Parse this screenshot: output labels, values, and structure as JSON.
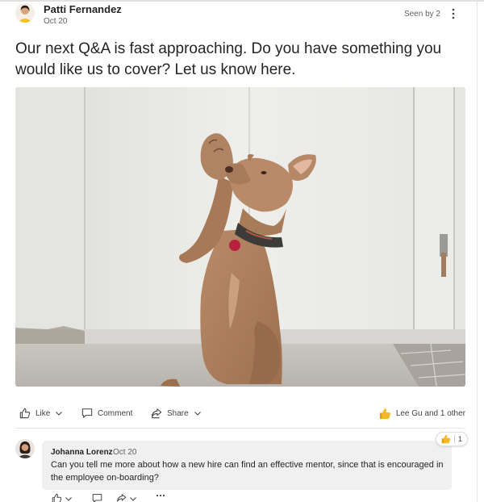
{
  "post": {
    "author": "Patti Fernandez",
    "date": "Oct 20",
    "seen_by": "Seen by 2",
    "text": "Our next Q&A is fast approaching. Do you have something you would like us to cover? Let us know here."
  },
  "actions": {
    "like_label": "Like",
    "comment_label": "Comment",
    "share_label": "Share",
    "reactors_label": "Lee Gu and 1 other"
  },
  "comment": {
    "author": "Johanna Lorenz",
    "date": "Oct 20",
    "text": "Can you tell me more about how a new hire can find an effective mentor, since that is encouraged in the employee on-boarding?",
    "reaction_count": "1"
  },
  "icons": {
    "more": "more-vertical-icon",
    "like": "thumbs-up-icon",
    "comment": "comment-icon",
    "share": "share-icon",
    "chevron": "chevron-down-icon",
    "reaction": "yellow-thumbs-up-icon"
  },
  "colors": {
    "reaction_yellow": "#f2b827",
    "text": "#242424",
    "secondary_text": "#616161",
    "comment_bg": "#f0f0f0"
  }
}
